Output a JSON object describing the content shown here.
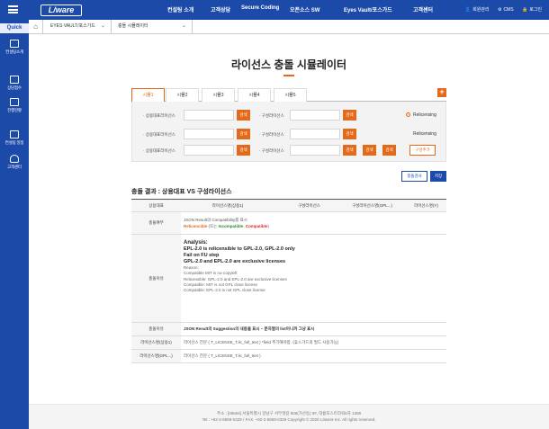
{
  "header": {
    "logo": "L/ware",
    "menu": [
      "컨설팅 소개",
      "고객상담",
      "Secure Coding",
      "오픈소스 SW",
      "Eyes Vault/포스가드",
      "고객센터"
    ],
    "utilities": [
      "회원관리",
      "CMS",
      "로그인"
    ]
  },
  "sidebar": {
    "quick_label": "Quick",
    "items": [
      "컨설팅소개",
      "상담접수",
      "진행현황",
      "컨설팅 일정",
      "고객센터"
    ]
  },
  "breadcrumb": {
    "level1": "EYES VAULT/포스가드",
    "level2": "충돌 시뮬레이터"
  },
  "page": {
    "title": "라이선스 충돌 시뮬레이터"
  },
  "tabs": [
    "시뮬1",
    "시뮬2",
    "시뮬3",
    "시뮬4",
    "시뮬5"
  ],
  "filters": {
    "rows": [
      {
        "label1": "· 상용대표라이선스",
        "btn1": "검색",
        "label2": "· 구성라이선스",
        "btn2": "검색",
        "radio": "Relicensing",
        "radio_on": true
      },
      {
        "label1": "· 상용대표라이선스",
        "btn1": "검색",
        "label2": "· 구성라이선스",
        "btn2": "검색",
        "radio": "Relicensing",
        "radio_on": false
      },
      {
        "label1": "· 상용대표라이선스",
        "btn1": "검색",
        "label2": "· 구성라이선스",
        "btn2": "검색",
        "btn3": "검색",
        "btn4": "검색"
      }
    ],
    "add_component": "구성추가"
  },
  "actions": {
    "check": "충돌검사",
    "save": "저장"
  },
  "result": {
    "title": "충돌 결과 : 상용대표 VS 구성라이선스",
    "headers": [
      "상용대표",
      "라이선스명(상용1)",
      "구성라이선스",
      "구성라이선스명(GPL...)",
      "라이선스명(Y)"
    ],
    "row1": {
      "label": "충돌여부",
      "line1": "JSON Result의 Compatibility를 표시",
      "relicensible": "Relicencible",
      "mid": " (또는 ",
      "incompatible": "Incompatible",
      "comma": ", ",
      "compatible": "Compatible",
      "end": ")"
    },
    "row2": {
      "label": "충돌이유",
      "analysis_title": "Analysis:",
      "big": [
        "EPL-2.0 is relicensible to GPL-2.0, GPL-2.0 only",
        "Fail on FU step",
        "GPL-2.0 and EPL-2.0 are exclusive licenses"
      ],
      "reason_label": "Reason:",
      "small": [
        "Compatible MIT is no-copyleft",
        "Relicensible: GPL-2.0 and EPL-2.0 are exclusive licenses",
        "Compatible: MIT is not GPL close license",
        "Compatible: EPL-2.0 is not GPL close license"
      ]
    },
    "row3": {
      "label": "충돌이유",
      "text": "JSON Result의 Suggestion의 내용을 표시 – 문자열의 list이니까 그냥 표시"
    },
    "row4": {
      "label": "라이선스명(상용1)",
      "text": "라이선스 전문 ( T_LICENSE_T.lic_full_text ) *field 추가해야함. (휴스가드의 필드 사용가능)"
    },
    "row5": {
      "label": "라이선스명(GPL...)",
      "text": "라이선스 전문 ( T_LICENSE_T.lic_full_text )"
    }
  },
  "footer": {
    "line1": "주소 : [06504] 서울특별시 강남구 서부샛길 606(가산동) 5F, 대륭포스트타워5차 1308",
    "line2": "Tel : +82-2-6959-0329 / FAX. +82-2-6959-0329   Copyright © 2020 L3ware Inc. All rights reserved."
  }
}
